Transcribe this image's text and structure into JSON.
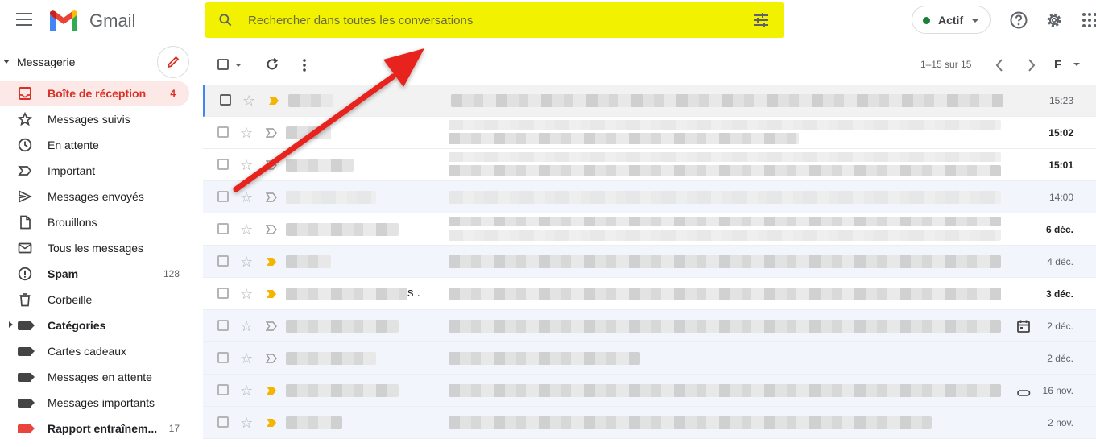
{
  "app": {
    "brand": "Gmail"
  },
  "search": {
    "placeholder": "Rechercher dans toutes les conversations"
  },
  "status": {
    "label": "Actif",
    "color": "#188038"
  },
  "sidebar": {
    "section_label": "Messagerie",
    "items": [
      {
        "label": "Boîte de réception",
        "count": "4",
        "icon": "inbox-icon"
      },
      {
        "label": "Messages suivis",
        "count": "",
        "icon": "star-icon"
      },
      {
        "label": "En attente",
        "count": "",
        "icon": "clock-icon"
      },
      {
        "label": "Important",
        "count": "",
        "icon": "important-icon"
      },
      {
        "label": "Messages envoyés",
        "count": "",
        "icon": "send-icon"
      },
      {
        "label": "Brouillons",
        "count": "",
        "icon": "draft-icon"
      },
      {
        "label": "Tous les messages",
        "count": "",
        "icon": "mail-icon"
      },
      {
        "label": "Spam",
        "count": "128",
        "icon": "spam-icon"
      },
      {
        "label": "Corbeille",
        "count": "",
        "icon": "trash-icon"
      },
      {
        "label": "Catégories",
        "count": "",
        "icon": "label-icon"
      },
      {
        "label": "Cartes cadeaux",
        "count": "",
        "icon": "label-icon"
      },
      {
        "label": "Messages en attente",
        "count": "",
        "icon": "label-icon"
      },
      {
        "label": "Messages importants",
        "count": "",
        "icon": "label-icon"
      },
      {
        "label": "Rapport entraînem...",
        "count": "17",
        "icon": "label-red-icon"
      }
    ]
  },
  "toolbar": {
    "pagination": "1–15 sur 15",
    "density_label": "F"
  },
  "mails": [
    {
      "date": "15:23",
      "unread": false,
      "important": true
    },
    {
      "date": "15:02",
      "unread": true,
      "important": false
    },
    {
      "date": "15:01",
      "unread": true,
      "important": false
    },
    {
      "date": "14:00",
      "unread": false,
      "important": false
    },
    {
      "date": "6 déc.",
      "unread": true,
      "important": false
    },
    {
      "date": "4 déc.",
      "unread": false,
      "important": true
    },
    {
      "date": "3 déc.",
      "unread": true,
      "important": true,
      "sender_suffix": "s ."
    },
    {
      "date": "2 déc.",
      "unread": false,
      "important": false,
      "extra_icon": "calendar-icon"
    },
    {
      "date": "2 déc.",
      "unread": false,
      "important": false
    },
    {
      "date": "16 nov.",
      "unread": false,
      "important": true,
      "extra_icon": "attachment-icon"
    },
    {
      "date": "2 nov.",
      "unread": false,
      "important": true
    }
  ],
  "colors": {
    "highlight": "#f2f200",
    "accent": "#d93025",
    "arrow": "#e8221b",
    "important": "#f4b400"
  }
}
